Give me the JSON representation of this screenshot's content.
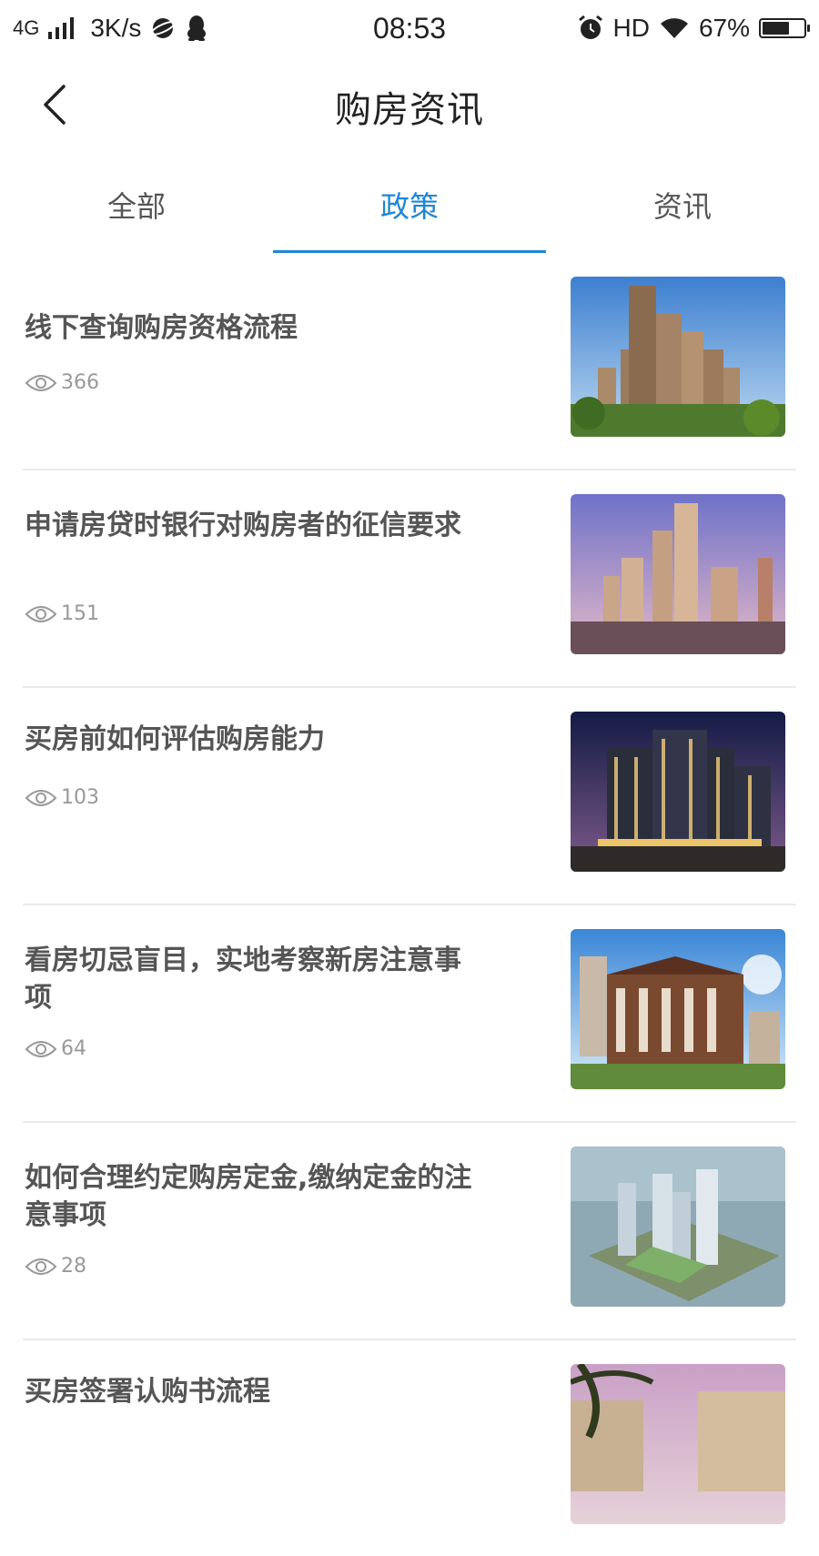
{
  "status_bar": {
    "network": "4G",
    "speed": "3K/s",
    "time": "08:53",
    "hd": "HD",
    "battery": "67%",
    "battery_level": 0.67
  },
  "header": {
    "title": "购房资讯"
  },
  "tabs": [
    {
      "label": "全部",
      "active": false
    },
    {
      "label": "政策",
      "active": true
    },
    {
      "label": "资讯",
      "active": false
    }
  ],
  "articles": [
    {
      "title": "线下查询购房资格流程",
      "views": "366"
    },
    {
      "title": "申请房贷时银行对购房者的征信要求",
      "views": "151"
    },
    {
      "title": "买房前如何评估购房能力",
      "views": "103"
    },
    {
      "title": "看房切忌盲目，实地考察新房注意事项",
      "views": "64"
    },
    {
      "title": "如何合理约定购房定金,缴纳定金的注意事项",
      "views": "28"
    },
    {
      "title": "买房签署认购书流程",
      "views": ""
    }
  ],
  "colors": {
    "accent": "#1f86d6",
    "divider": "#eaeaea",
    "meta": "#999999"
  }
}
